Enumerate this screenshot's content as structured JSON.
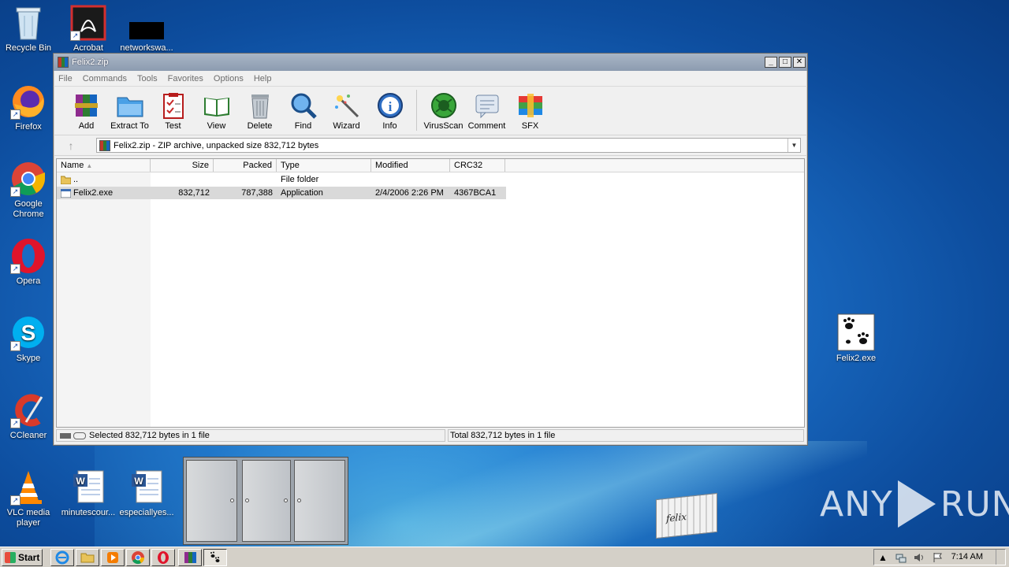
{
  "desktop": {
    "icons": [
      {
        "label": "Recycle Bin"
      },
      {
        "label": "Acrobat"
      },
      {
        "label": "networkswa..."
      },
      {
        "label": "Firefox"
      },
      {
        "label": "Google Chrome"
      },
      {
        "label": "Opera"
      },
      {
        "label": "Skype"
      },
      {
        "label": "CCleaner"
      },
      {
        "label": "VLC media player"
      },
      {
        "label": "minutescour..."
      },
      {
        "label": "especiallyes..."
      },
      {
        "label": "Felix2.exe"
      }
    ],
    "box_label": "felix",
    "watermark": {
      "left": "ANY",
      "right": "RUN"
    }
  },
  "window": {
    "title": "Felix2.zip",
    "controls": {
      "minimize": "_",
      "maximize": "□",
      "close": "✕"
    },
    "menu": [
      "File",
      "Commands",
      "Tools",
      "Favorites",
      "Options",
      "Help"
    ],
    "toolbar": [
      {
        "label": "Add",
        "icon": "add-archive-icon"
      },
      {
        "label": "Extract To",
        "icon": "extract-folder-icon"
      },
      {
        "label": "Test",
        "icon": "test-clipboard-icon"
      },
      {
        "label": "View",
        "icon": "view-book-icon"
      },
      {
        "label": "Delete",
        "icon": "trash-icon"
      },
      {
        "label": "Find",
        "icon": "magnifier-icon"
      },
      {
        "label": "Wizard",
        "icon": "magic-wand-icon"
      },
      {
        "label": "Info",
        "icon": "info-icon"
      },
      {
        "label": "VirusScan",
        "icon": "virus-icon"
      },
      {
        "label": "Comment",
        "icon": "comment-icon"
      },
      {
        "label": "SFX",
        "icon": "sfx-books-icon"
      }
    ],
    "address": "Felix2.zip - ZIP archive, unpacked size 832,712 bytes",
    "columns": [
      "Name",
      "Size",
      "Packed",
      "Type",
      "Modified",
      "CRC32"
    ],
    "rows": [
      {
        "name": "..",
        "size": "",
        "packed": "",
        "type": "File folder",
        "modified": "",
        "crc": ""
      },
      {
        "name": "Felix2.exe",
        "size": "832,712",
        "packed": "787,388",
        "type": "Application",
        "modified": "2/4/2006 2:26 PM",
        "crc": "4367BCA1"
      }
    ],
    "status_left": "Selected 832,712 bytes in 1 file",
    "status_right": "Total 832,712 bytes in 1 file"
  },
  "taskbar": {
    "start_label": "Start",
    "clock": "7:14 AM",
    "tray_expand": "▲"
  }
}
